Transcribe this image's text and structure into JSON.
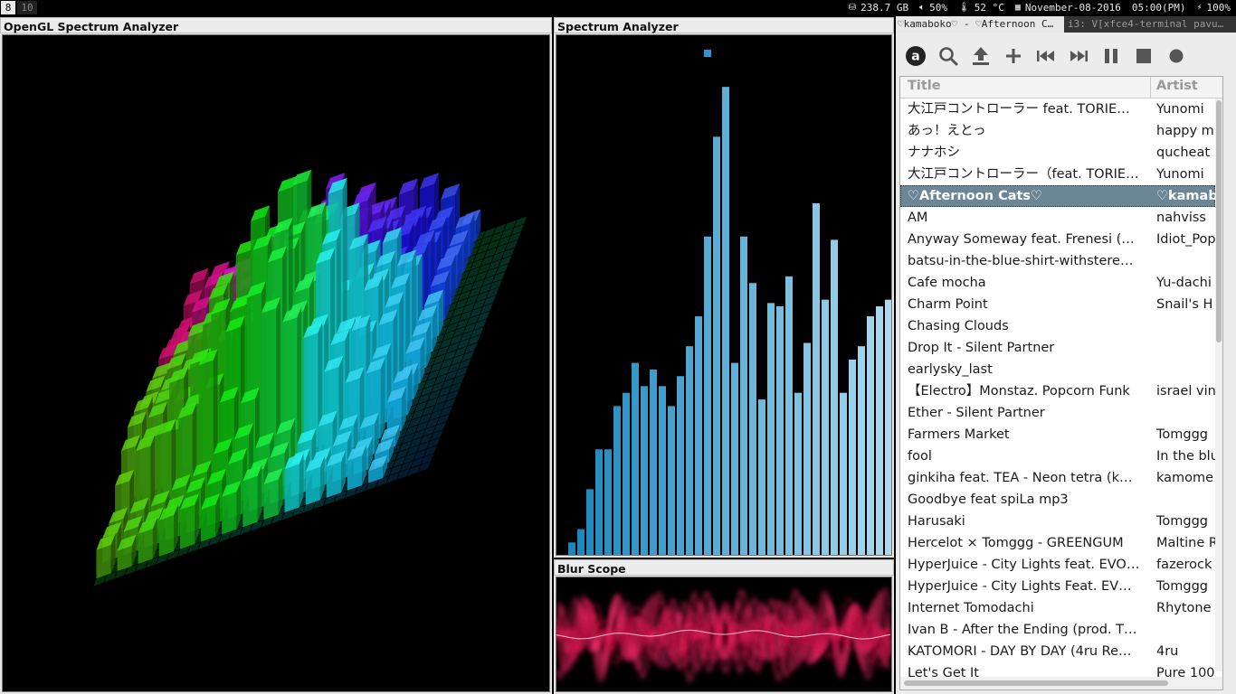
{
  "workspaces": [
    "8",
    "10"
  ],
  "status": {
    "disk": "238.7 GB",
    "volume": "50%",
    "temp": "52 °C",
    "date": "November-08-2016",
    "time": "05:00(PM)",
    "battery": "100%"
  },
  "panes": {
    "opengl_title": "OpenGL Spectrum Analyzer",
    "spectrum_title": "Spectrum Analyzer",
    "blur_title": "Blur Scope"
  },
  "audacious": {
    "tab_active": "♡kamaboko♡ - ♡Afternoon C…",
    "tab_inactive": "i3: V[xfce4-terminal pavu…",
    "columns": {
      "title": "Title",
      "artist": "Artist"
    },
    "selected_index": 4,
    "playlist": [
      {
        "title": "大江戸コントローラー feat. TORIE…",
        "artist": "Yunomi"
      },
      {
        "title": "あっ！えとっ",
        "artist": "happy m"
      },
      {
        "title": "ナナホシ",
        "artist": "qucheat"
      },
      {
        "title": "大江戸コントローラー（feat. TORIE…",
        "artist": "Yunomi"
      },
      {
        "title": "♡Afternoon Cats♡",
        "artist": "♡kamab"
      },
      {
        "title": "AM",
        "artist": "nahviss"
      },
      {
        "title": "Anyway Someway feat. Frenesi (…",
        "artist": "Idiot_Pop"
      },
      {
        "title": "batsu-in-the-blue-shirt-withstere…",
        "artist": ""
      },
      {
        "title": "Cafe mocha",
        "artist": "Yu-dachi"
      },
      {
        "title": "Charm Point",
        "artist": "Snail's H"
      },
      {
        "title": "Chasing Clouds",
        "artist": ""
      },
      {
        "title": "Drop It - Silent Partner",
        "artist": ""
      },
      {
        "title": "earlysky_last",
        "artist": ""
      },
      {
        "title": "【Electro】Monstaz. Popcorn Funk",
        "artist": "israel vin"
      },
      {
        "title": "Ether - Silent Partner",
        "artist": ""
      },
      {
        "title": "Farmers Market",
        "artist": "Tomggg"
      },
      {
        "title": "fool",
        "artist": "In the blu"
      },
      {
        "title": "ginkiha feat. TEA - Neon tetra (k…",
        "artist": "kamome"
      },
      {
        "title": "Goodbye feat spiLa mp3",
        "artist": ""
      },
      {
        "title": "Harusaki",
        "artist": "Tomggg"
      },
      {
        "title": "Hercelot × Tomggg - GREENGUM",
        "artist": "Maltine R"
      },
      {
        "title": "HyperJuice - City Lights feat. EVO…",
        "artist": "fazerock"
      },
      {
        "title": "HyperJuice - City Lights Feat. EV…",
        "artist": "Tomggg"
      },
      {
        "title": "Internet Tomodachi",
        "artist": "Rhytone"
      },
      {
        "title": "Ivan B - After the Ending (prod. T…",
        "artist": ""
      },
      {
        "title": "KATOMORI - DAY BY DAY (4ru Re…",
        "artist": "4ru"
      },
      {
        "title": "Let's Get It",
        "artist": "Pure 100"
      }
    ]
  },
  "spectrum_values": [
    4,
    8,
    20,
    32,
    32,
    45,
    49,
    58,
    51,
    56,
    51,
    45,
    54,
    63,
    72,
    96,
    126,
    141,
    58,
    96,
    82,
    47,
    76,
    75,
    84,
    49,
    64,
    106,
    77,
    95,
    49,
    59,
    63,
    72,
    75,
    77,
    72,
    48,
    58,
    58,
    33,
    59,
    51,
    19,
    16
  ],
  "colors": {
    "bar_left": "#1a86bd",
    "bar_right": "#d2eefb",
    "selection": "#6b8696",
    "scope": "#ff2d6f"
  }
}
